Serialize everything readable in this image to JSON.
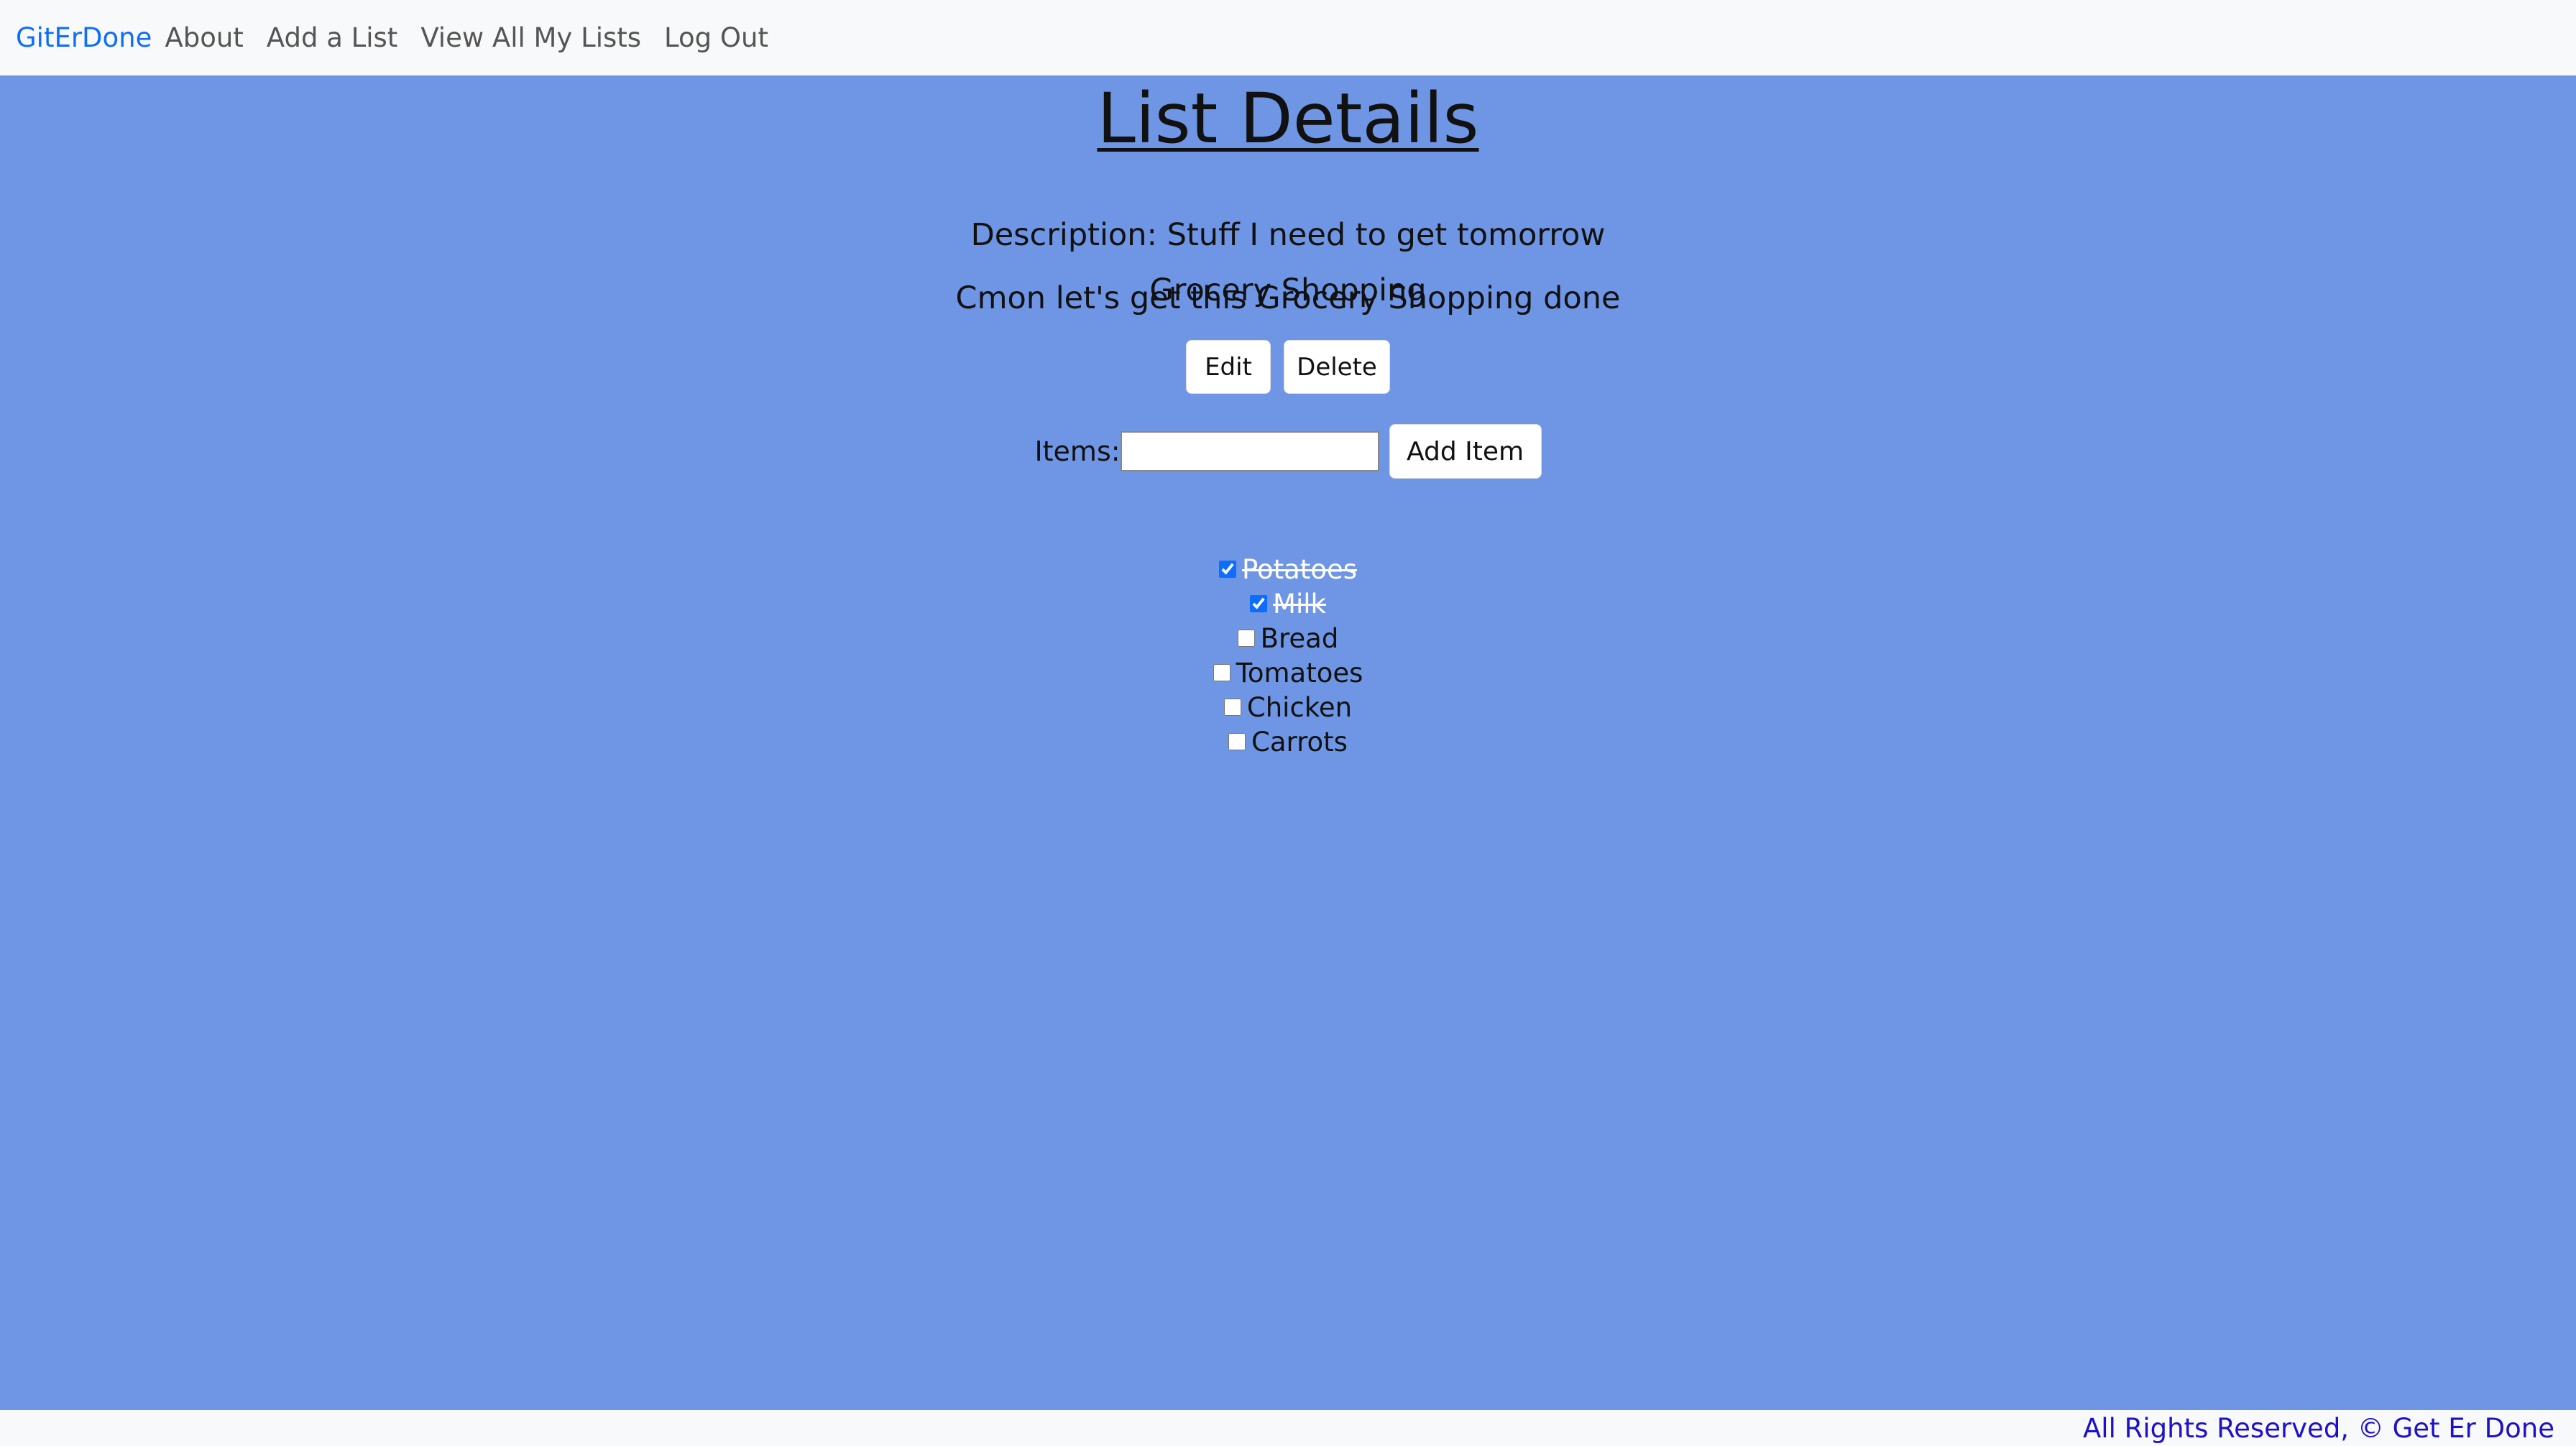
{
  "nav": {
    "brand": "GitErDone",
    "links": [
      "About",
      "Add a List",
      "View All My Lists",
      "Log Out"
    ]
  },
  "page": {
    "title": "List Details",
    "list_name": "Grocery Shopping",
    "description": "Description: Stuff I need to get tomorrow",
    "motivation": "Cmon let's get this Grocery Shopping done"
  },
  "actions": {
    "edit_label": "Edit",
    "delete_label": "Delete"
  },
  "add_item": {
    "label": "Items:",
    "value": "",
    "button_label": "Add Item"
  },
  "items": [
    {
      "label": "Potatoes",
      "checked": true
    },
    {
      "label": "Milk",
      "checked": true
    },
    {
      "label": "Bread",
      "checked": false
    },
    {
      "label": "Tomatoes",
      "checked": false
    },
    {
      "label": "Chicken",
      "checked": false
    },
    {
      "label": "Carrots",
      "checked": false
    }
  ],
  "footer": {
    "text": "All Rights Reserved, © Get Er Done"
  },
  "colors": {
    "background": "#6f95e5",
    "brand": "#0d6efd",
    "footer_text": "#1c10c9"
  }
}
